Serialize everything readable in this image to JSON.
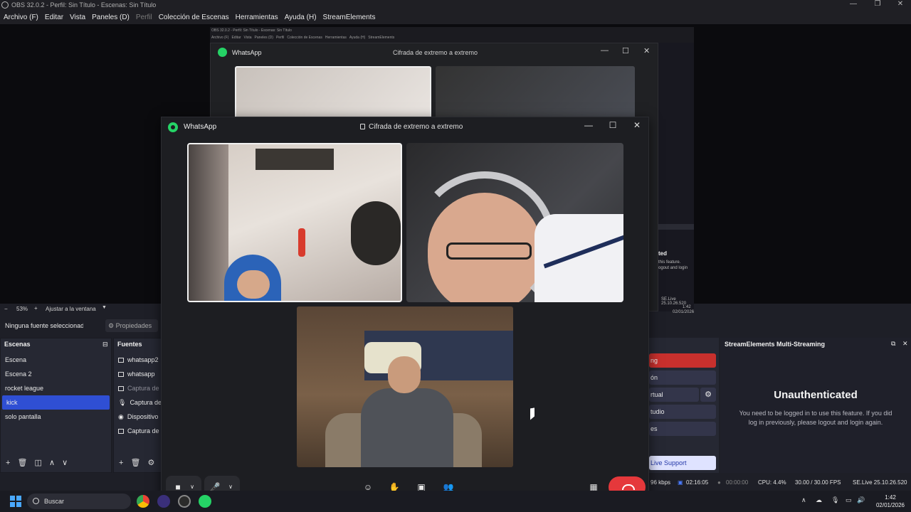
{
  "obs": {
    "window_title": "OBS 32.0.2 - Perfil: Sin Título - Escenas: Sin Título",
    "menu": [
      "Archivo (F)",
      "Editar",
      "Vista",
      "Paneles (D)",
      "Perfil",
      "Colección de Escenas",
      "Herramientas",
      "Ayuda (H)",
      "StreamElements"
    ],
    "zoom": "53%",
    "fit_label": "Ajustar a la ventana",
    "no_source": "Ninguna fuente seleccionada",
    "properties_label": "Propiedades"
  },
  "nested": {
    "title": "OBS 32.0.2 - Perfil: Sin Título - Escenas: Sin Título",
    "menu": [
      "Archivo (F)",
      "Editar",
      "Vista",
      "Paneles (D)",
      "Perfil",
      "Colección de Escenas",
      "Herramientas",
      "Ayuda (H)",
      "StreamElements"
    ],
    "wa_title": "WhatsApp",
    "encryption": "Cifrada de extremo a extremo",
    "strip": {
      "line1": "ted",
      "line2": "this feature.",
      "line3": "ogout and login",
      "status": "SE.Live 25.10.26.520",
      "time": "1:42",
      "date": "02/01/2026"
    }
  },
  "whatsapp": {
    "title": "WhatsApp",
    "encryption": "Cifrada de extremo a extremo"
  },
  "scenes": {
    "title": "Escenas",
    "items": [
      "Escena",
      "Escena 2",
      "rocket league",
      "kick",
      "solo pantalla"
    ],
    "selected": "kick"
  },
  "sources": {
    "title": "Fuentes",
    "items": [
      "whatsapp2",
      "whatsapp",
      "Captura de",
      "Captura de",
      "Dispositivo",
      "Captura de"
    ]
  },
  "controls": {
    "streaming": "ng",
    "recording": "ón",
    "virtual": "rtual",
    "studio": "tudio",
    "settings": "es",
    "support": "Live Support"
  },
  "se_dock": {
    "title": "StreamElements Multi-Streaming",
    "heading": "Unauthenticated",
    "message": "You need to be logged in to use this feature. If you did log in previously, please logout and login again."
  },
  "status": {
    "bitrate": "96 kbps",
    "rec_time": "02:16:05",
    "stream_time": "00:00:00",
    "cpu": "CPU: 4.4%",
    "fps": "30.00 / 30.00 FPS",
    "version": "SE.Live 25.10.26.520"
  },
  "taskbar": {
    "search": "Buscar",
    "time": "1:42",
    "date": "02/01/2026"
  },
  "colors": {
    "accent": "#2f4fd4",
    "end_call": "#e5383b",
    "whatsapp": "#25d366",
    "stream_red": "#c8302d"
  }
}
